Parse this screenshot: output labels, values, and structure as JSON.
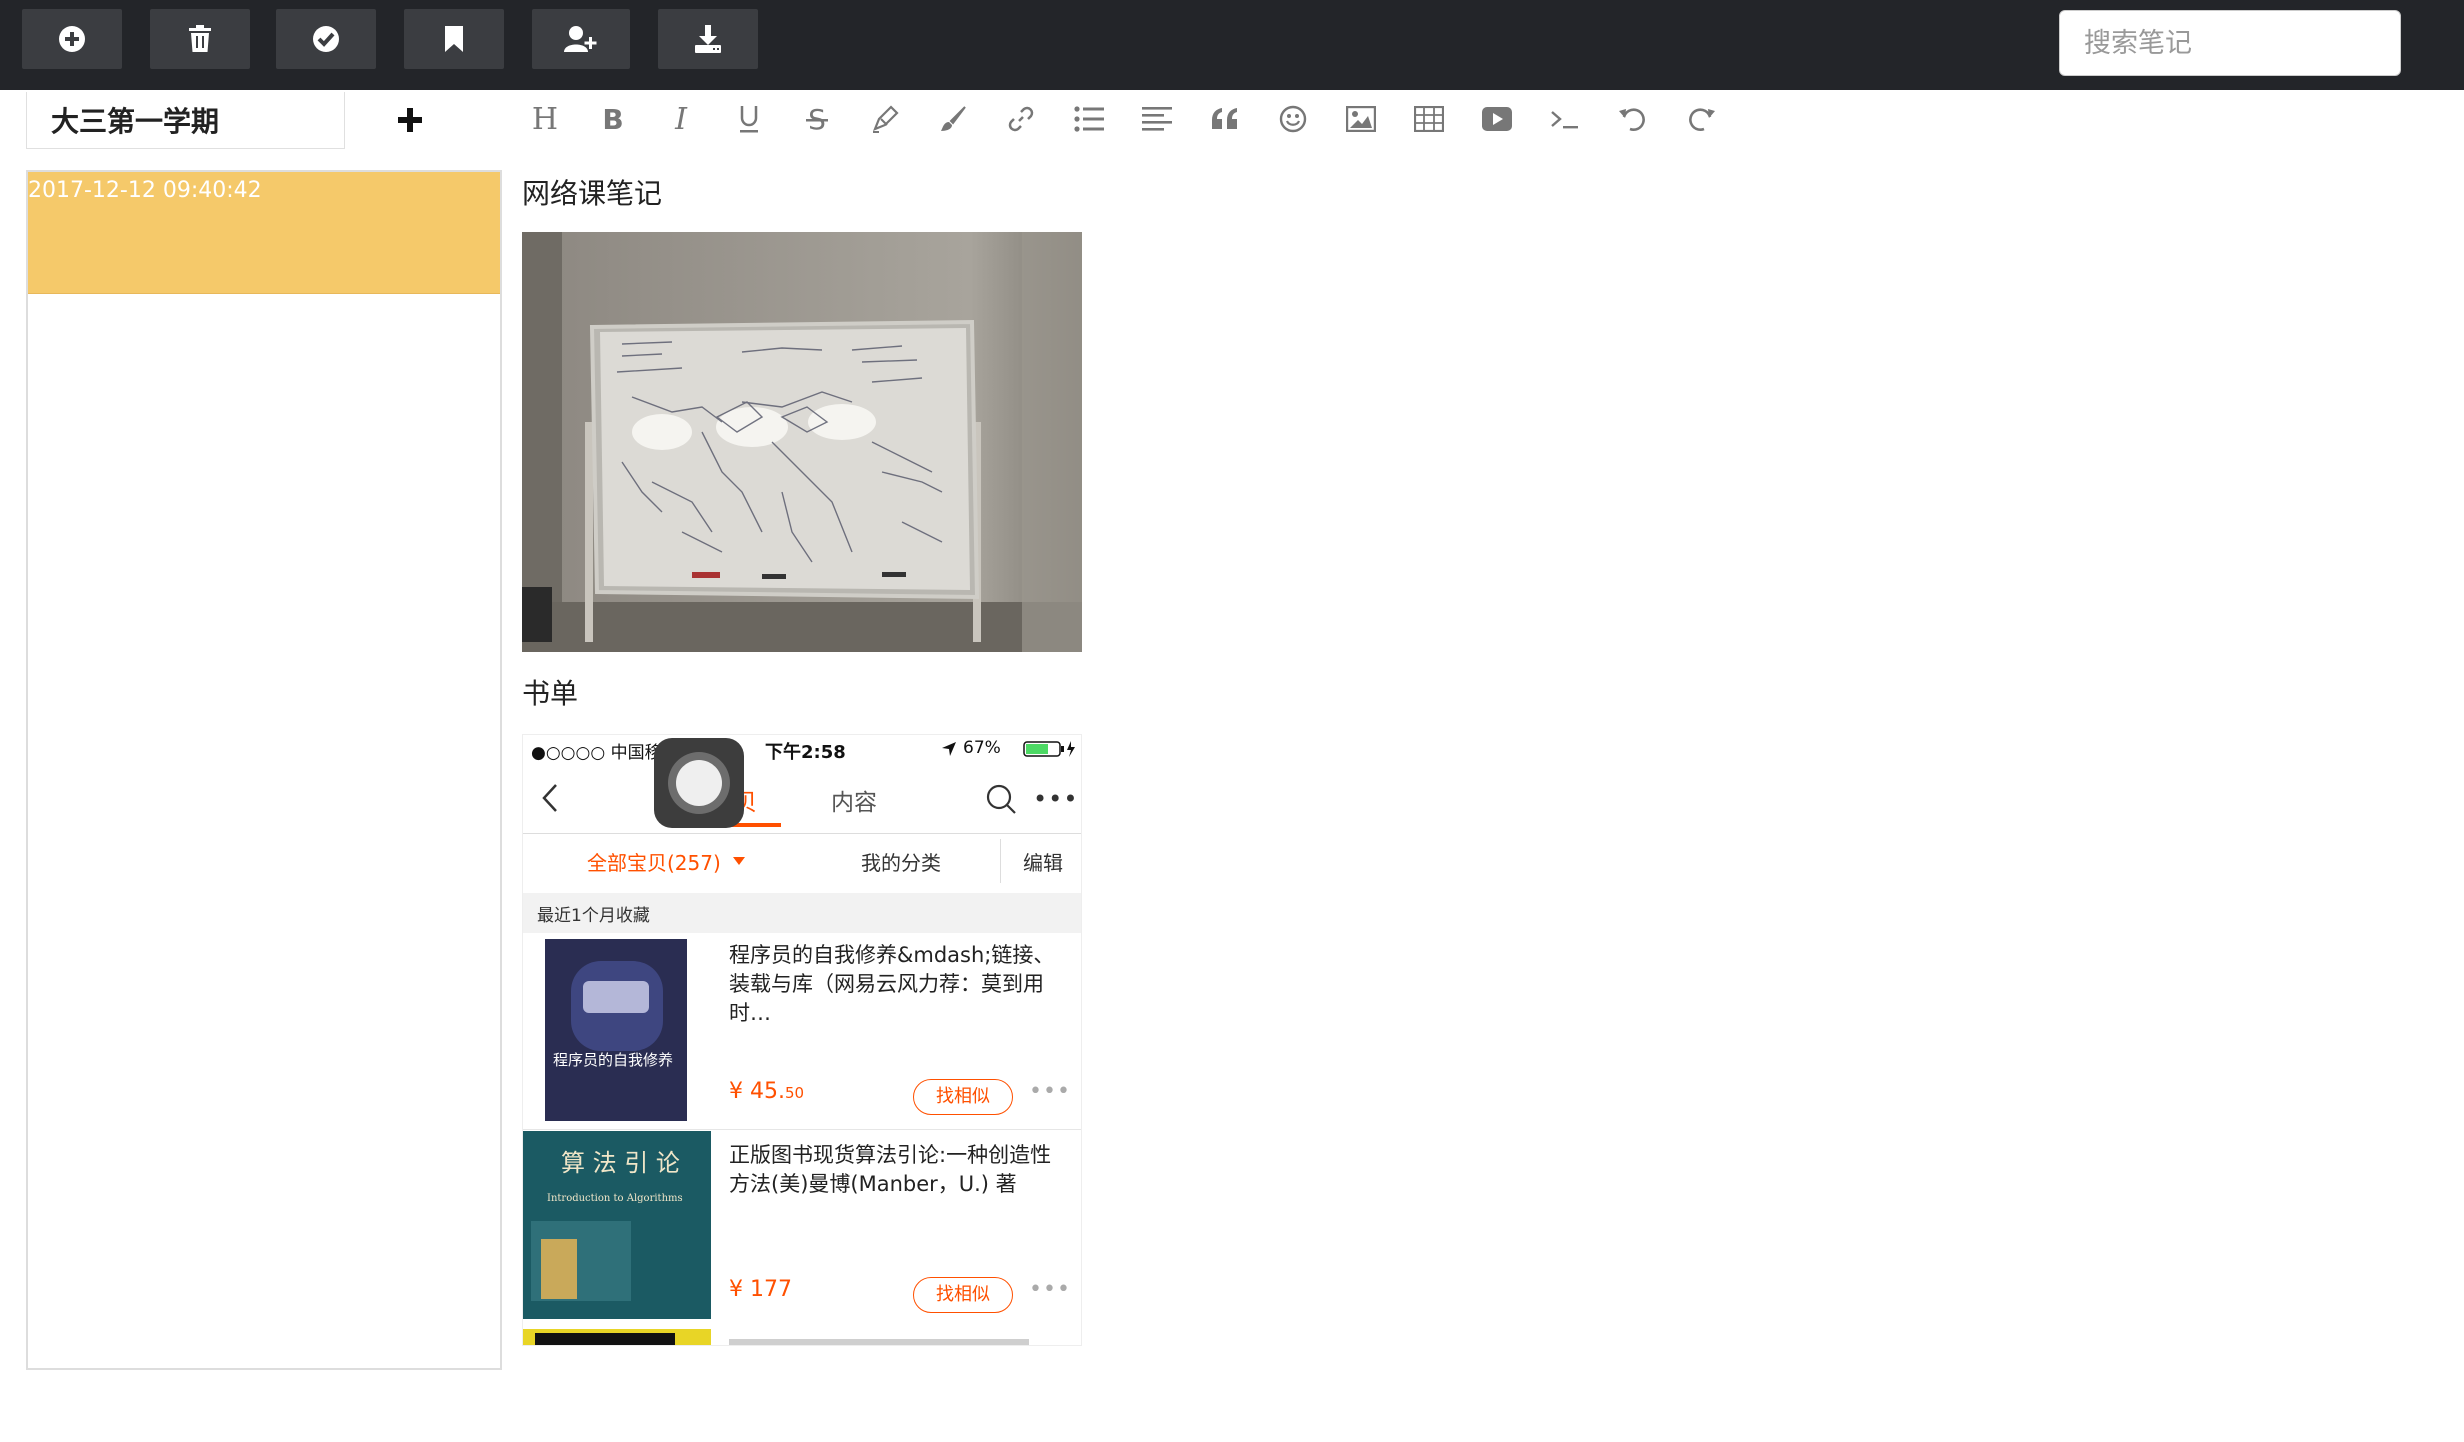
{
  "toolbar": {
    "buttons": [
      {
        "name": "new-note",
        "icon": "plus-circle-icon"
      },
      {
        "name": "delete-note",
        "icon": "trash-icon"
      },
      {
        "name": "save-note",
        "icon": "check-circle-icon"
      },
      {
        "name": "bookmark-note",
        "icon": "bookmark-icon"
      },
      {
        "name": "share-note",
        "icon": "user-plus-icon"
      },
      {
        "name": "download-note",
        "icon": "download-icon"
      }
    ],
    "search_placeholder": "搜索笔记"
  },
  "notebook": {
    "title": "大三第一学期",
    "add_symbol": "✚"
  },
  "editor_tools": [
    "heading",
    "bold",
    "italic",
    "underline",
    "strikethrough",
    "highlighter",
    "brush",
    "link",
    "bullet-list",
    "align-left",
    "quote",
    "emoji",
    "image",
    "table",
    "video",
    "code",
    "undo",
    "redo"
  ],
  "notes": [
    {
      "time": "2017-12-12 09:40:42",
      "selected": true
    }
  ],
  "content": {
    "heading1": "网络课笔记",
    "heading2": "书单"
  },
  "phone": {
    "carrier": "●○○○○ 中国移动",
    "time": "下午2:58",
    "battery": "67%",
    "tab_active": "宝贝",
    "tab_other": "内容",
    "filter_all": "全部宝贝(257)",
    "filter_category": "我的分类",
    "filter_edit": "编辑",
    "section_label": "最近1个月收藏",
    "books": [
      {
        "title": "程序员的自我修养&mdash;链接、装载与库（网易云风力荐：莫到用时…",
        "price_int": "¥ 45.",
        "price_dec": "50",
        "similar": "找相似",
        "cover_text": "程序员的自我修养"
      },
      {
        "title": "正版图书现货算法引论:一种创造性方法(美)曼博(Manber，U.) 著",
        "price_int": "¥ 177",
        "price_dec": "",
        "similar": "找相似",
        "cover_text": "算 法 引 论",
        "cover_subtext": "Introduction to Algorithms"
      }
    ]
  },
  "colors": {
    "topbar": "#232529",
    "button_bg": "#3b3d41",
    "selected_note": "#f5c96a",
    "accent_orange": "#ff5000"
  }
}
